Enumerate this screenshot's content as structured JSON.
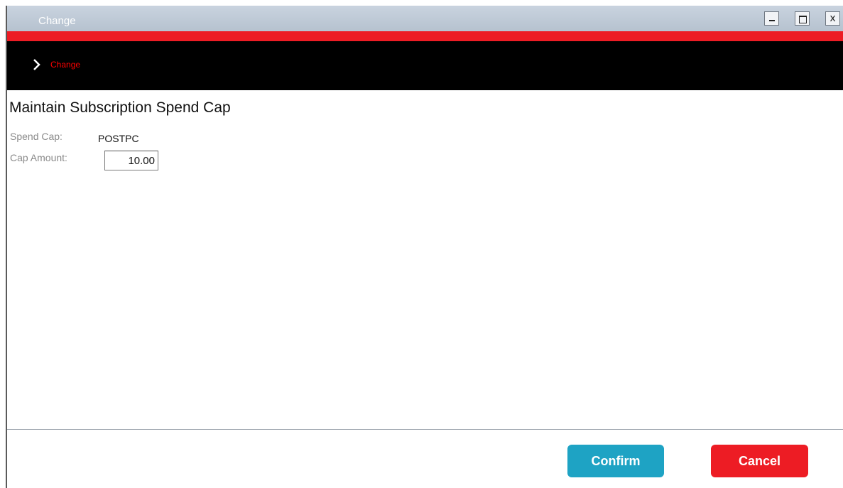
{
  "window": {
    "title": "Change",
    "controls": [
      "minimize-icon",
      "maximize-icon",
      "close-icon"
    ],
    "close_glyph": "x"
  },
  "nav": {
    "breadcrumb": "Change"
  },
  "form": {
    "heading": "Maintain Subscription Spend Cap",
    "spend_cap_label": "Spend Cap:",
    "spend_cap_value": "POSTPC",
    "cap_amount_label": "Cap Amount:",
    "cap_amount_value": "10.00"
  },
  "footer": {
    "confirm_label": "Confirm",
    "cancel_label": "Cancel"
  },
  "colors": {
    "red_band": "#ed1c24",
    "nav_background": "#000000",
    "breadcrumb_text": "#ff0000",
    "confirm_button": "#1ea3c4",
    "cancel_button": "#ed1c24"
  }
}
